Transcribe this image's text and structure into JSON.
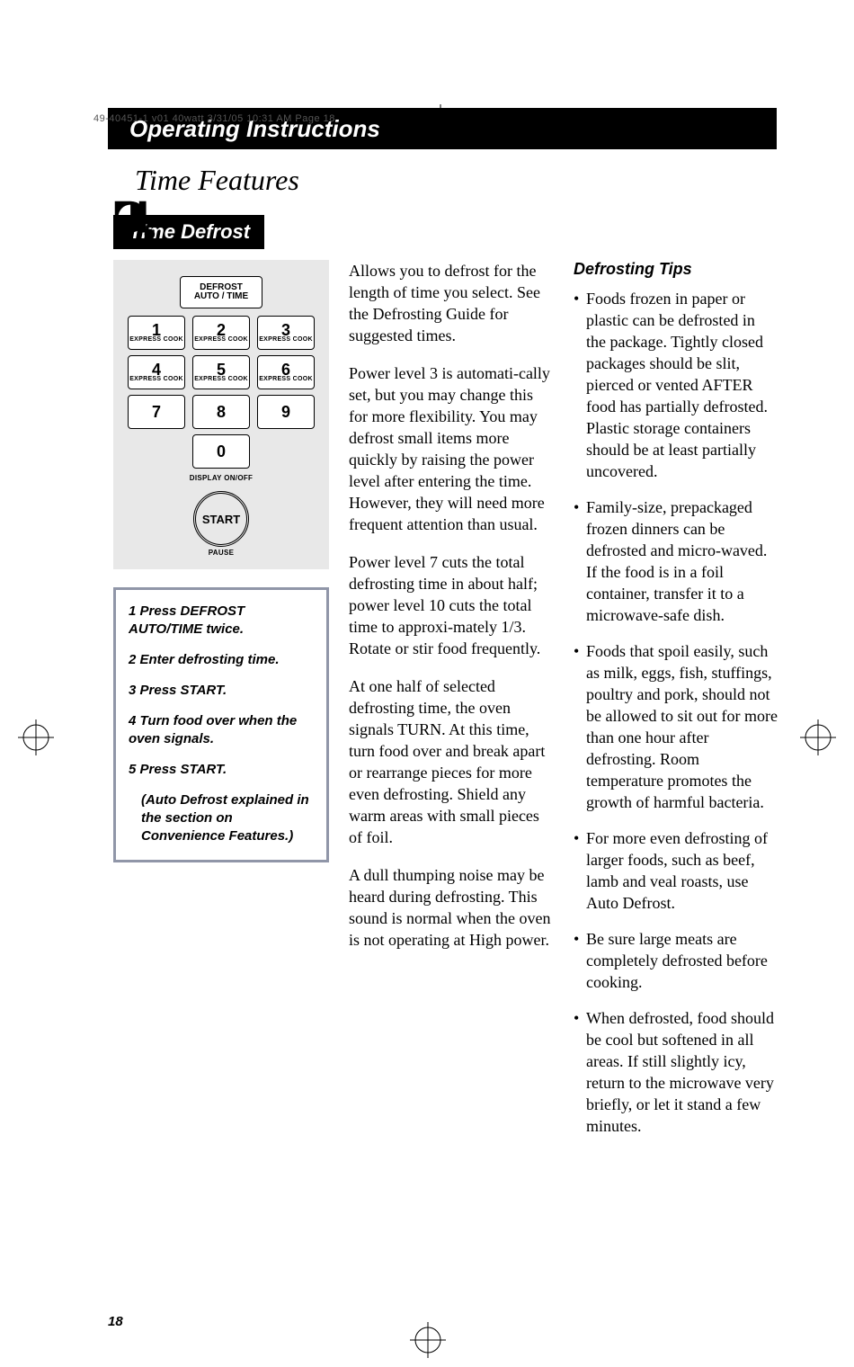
{
  "crop_top": "49-40451-1 v01 40watt  3/31/05  10:31 AM  Page 18",
  "section_header": "Operating Instructions",
  "subtitle": "Time Features",
  "subhead": "Time Defrost",
  "keypad": {
    "defrost": "DEFROST\nAUTO / TIME",
    "label_express": "EXPRESS COOK",
    "display": "DISPLAY ON/OFF",
    "start": "START",
    "pause": "PAUSE",
    "keys": [
      "1",
      "2",
      "3",
      "4",
      "5",
      "6",
      "7",
      "8",
      "9",
      "0"
    ]
  },
  "steps": [
    "1  Press DEFROST AUTO/TIME twice.",
    "2  Enter defrosting time.",
    "3  Press START.",
    "4  Turn food over when the oven signals.",
    "5  Press START."
  ],
  "steps_note": "(Auto Defrost explained in the section on Convenience Features.)",
  "paragraphs": [
    "Allows you to defrost for the length of time you select. See the Defrosting Guide for suggested times.",
    "Power level 3 is automati-cally set, but you may change this for more flexibility. You may defrost small items more quickly by raising the power level after entering the time. However, they will need more frequent attention than usual.",
    "Power level 7 cuts the total defrosting time in about half; power level 10 cuts the total time to approxi-mately 1/3. Rotate or stir food frequently.",
    "At one half of selected defrosting time, the oven signals TURN. At this time, turn food over and break apart or rearrange pieces for more even defrosting. Shield any warm areas with small pieces of foil.",
    "A dull thumping noise may be heard during defrosting. This sound is normal when the oven is not operating at High power."
  ],
  "tips_title": "Defrosting Tips",
  "tips": [
    "Foods frozen in paper or plastic can be defrosted in the package. Tightly closed packages should be slit, pierced or vented AFTER food has partially defrosted. Plastic storage containers should be at least partially uncovered.",
    "Family-size, prepackaged frozen dinners can be defrosted and micro-waved. If the food is in a foil container, transfer it to a microwave-safe dish.",
    "Foods that spoil easily, such as milk, eggs, fish, stuffings, poultry and pork, should not be allowed to sit out for more than one hour after defrosting. Room temperature promotes the growth of harmful bacteria.",
    "For more even defrosting of larger foods, such as beef, lamb and veal roasts, use Auto Defrost.",
    "Be sure large meats are completely defrosted before cooking.",
    "When defrosted, food should be cool but softened in all areas. If still slightly icy, return to the microwave very briefly, or let it stand a few minutes."
  ],
  "page_number": "18"
}
